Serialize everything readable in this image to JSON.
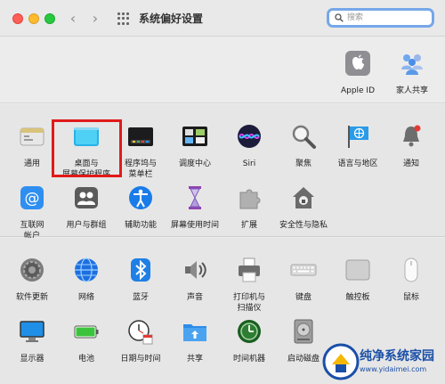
{
  "window": {
    "title": "系统偏好设置"
  },
  "search": {
    "placeholder": "搜索"
  },
  "account_panes": [
    {
      "id": "apple-id",
      "label": "Apple ID",
      "icon": "apple-logo-icon"
    },
    {
      "id": "family-sharing",
      "label": "家人共享",
      "icon": "family-icon"
    }
  ],
  "row1": [
    {
      "id": "general",
      "label": "通用",
      "icon": "general-icon"
    },
    {
      "id": "desktop-screensaver",
      "label": "桌面与屏幕保护程序",
      "label_lines": [
        "桌面与",
        "屏幕保护程序"
      ],
      "icon": "desktop-icon",
      "highlighted": true
    },
    {
      "id": "dock",
      "label_lines": [
        "程序坞与",
        "菜单栏"
      ],
      "icon": "dock-icon"
    },
    {
      "id": "mission-control",
      "label": "调度中心",
      "icon": "mission-control-icon"
    },
    {
      "id": "siri",
      "label": "Siri",
      "icon": "siri-icon"
    },
    {
      "id": "spotlight",
      "label": "聚焦",
      "icon": "magnifier-icon"
    },
    {
      "id": "language-region",
      "label": "语言与地区",
      "icon": "flag-icon"
    },
    {
      "id": "notifications",
      "label": "通知",
      "icon": "bell-icon"
    }
  ],
  "row2": [
    {
      "id": "internet-accounts",
      "label_lines": [
        "互联网",
        "帐户"
      ],
      "icon": "at-icon"
    },
    {
      "id": "users-groups",
      "label": "用户与群组",
      "icon": "users-icon"
    },
    {
      "id": "accessibility",
      "label": "辅助功能",
      "icon": "accessibility-icon"
    },
    {
      "id": "screen-time",
      "label": "屏幕使用时间",
      "icon": "hourglass-icon"
    },
    {
      "id": "extensions",
      "label": "扩展",
      "icon": "puzzle-icon"
    },
    {
      "id": "security-privacy",
      "label": "安全性与隐私",
      "icon": "house-lock-icon"
    }
  ],
  "row3": [
    {
      "id": "software-update",
      "label": "软件更新",
      "icon": "gear-icon"
    },
    {
      "id": "network",
      "label": "网络",
      "icon": "globe-icon"
    },
    {
      "id": "bluetooth",
      "label": "蓝牙",
      "icon": "bluetooth-icon"
    },
    {
      "id": "sound",
      "label": "声音",
      "icon": "speaker-icon"
    },
    {
      "id": "printers-scanners",
      "label_lines": [
        "打印机与",
        "扫描仪"
      ],
      "icon": "printer-icon"
    },
    {
      "id": "keyboard",
      "label": "键盘",
      "icon": "keyboard-icon"
    },
    {
      "id": "trackpad",
      "label": "触控板",
      "icon": "trackpad-icon"
    },
    {
      "id": "mouse",
      "label": "鼠标",
      "icon": "mouse-icon"
    }
  ],
  "row4": [
    {
      "id": "displays",
      "label": "显示器",
      "icon": "display-icon"
    },
    {
      "id": "battery",
      "label": "电池",
      "icon": "battery-icon"
    },
    {
      "id": "date-time",
      "label": "日期与时间",
      "icon": "clock-calendar-icon"
    },
    {
      "id": "sharing",
      "label": "共享",
      "icon": "sharing-folder-icon"
    },
    {
      "id": "time-machine",
      "label": "时间机器",
      "icon": "time-machine-icon"
    },
    {
      "id": "startup-disk",
      "label": "启动磁盘",
      "icon": "disk-icon"
    }
  ],
  "watermark": {
    "name": "纯净系统家园",
    "url": "www.yidaimei.com"
  },
  "colors": {
    "highlight": "#e11a1a",
    "search_focus": "#76a7e8",
    "watermark": "#1a4fa8"
  }
}
